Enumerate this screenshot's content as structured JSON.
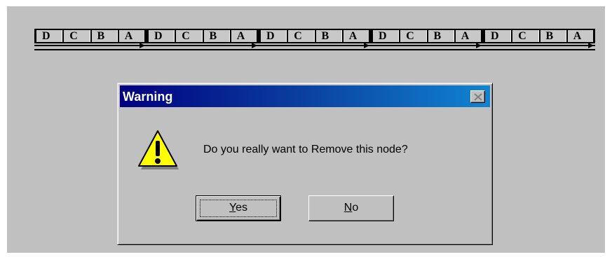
{
  "node_strip": {
    "groups": [
      [
        "D",
        "C",
        "B",
        "A"
      ],
      [
        "D",
        "C",
        "B",
        "A"
      ],
      [
        "D",
        "C",
        "B",
        "A"
      ],
      [
        "D",
        "C",
        "B",
        "A"
      ],
      [
        "D",
        "C",
        "B",
        "A"
      ]
    ]
  },
  "dialog": {
    "title": "Warning",
    "close_icon": "close-icon",
    "icon": "warning-icon",
    "message": "Do you really want to Remove this node?",
    "buttons": {
      "yes": {
        "mnemonic": "Y",
        "rest": "es"
      },
      "no": {
        "mnemonic": "N",
        "rest": "o"
      }
    }
  },
  "colors": {
    "titlebar_start": "#000080",
    "titlebar_end": "#1084d0",
    "face": "#c0c0c0",
    "warning_yellow": "#ffff00"
  }
}
